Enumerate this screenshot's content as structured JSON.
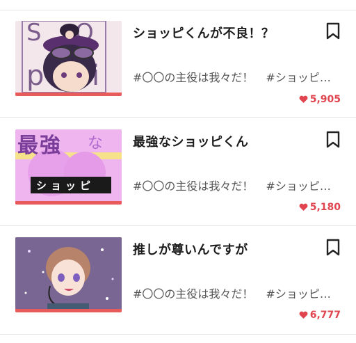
{
  "items": [
    {
      "title": "ショッピくんが不良！？",
      "tags": [
        "#〇〇の主役は我々だ！",
        "#ショッピ…"
      ],
      "likes": "5,905",
      "thumb_text": "S\nJo\npi",
      "icon": "bookmark-icon"
    },
    {
      "title": "最強なショッピくん",
      "tags": [
        "#〇〇の主役は我々だ！",
        "#ショッピ…"
      ],
      "likes": "5,180",
      "thumb_text_big": "最強",
      "thumb_text_small": "な",
      "thumb_banner": "ショッピ",
      "icon": "bookmark-icon"
    },
    {
      "title": "推しが尊いんですが",
      "tags": [
        "#〇〇の主役は我々だ！",
        "#ショッピ…"
      ],
      "likes": "6,777",
      "icon": "bookmark-icon"
    }
  ],
  "colors": {
    "accent": "#e85b5b",
    "likes": "#e0454f"
  }
}
